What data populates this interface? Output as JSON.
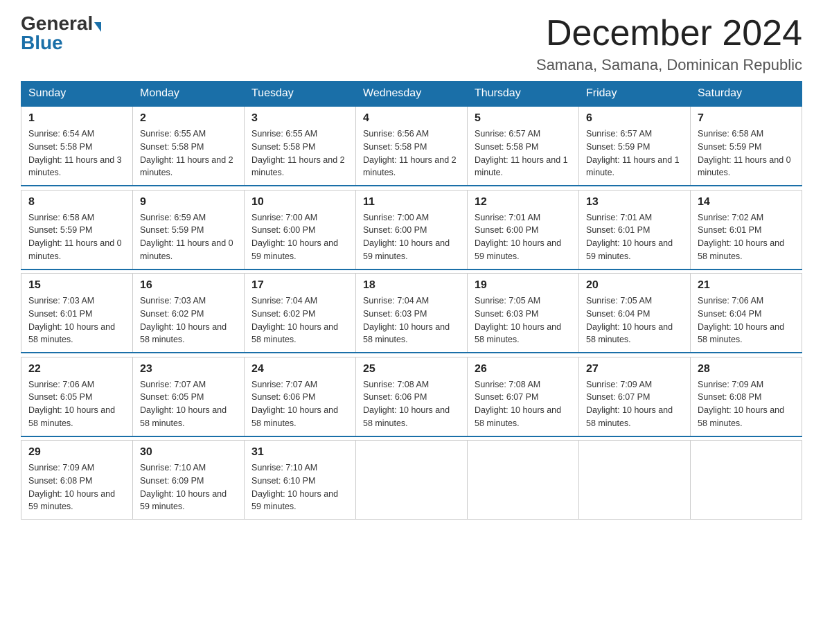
{
  "logo": {
    "general": "General",
    "blue": "Blue"
  },
  "title": "December 2024",
  "location": "Samana, Samana, Dominican Republic",
  "days_header": [
    "Sunday",
    "Monday",
    "Tuesday",
    "Wednesday",
    "Thursday",
    "Friday",
    "Saturday"
  ],
  "weeks": [
    [
      {
        "day": "1",
        "sunrise": "6:54 AM",
        "sunset": "5:58 PM",
        "daylight": "11 hours and 3 minutes."
      },
      {
        "day": "2",
        "sunrise": "6:55 AM",
        "sunset": "5:58 PM",
        "daylight": "11 hours and 2 minutes."
      },
      {
        "day": "3",
        "sunrise": "6:55 AM",
        "sunset": "5:58 PM",
        "daylight": "11 hours and 2 minutes."
      },
      {
        "day": "4",
        "sunrise": "6:56 AM",
        "sunset": "5:58 PM",
        "daylight": "11 hours and 2 minutes."
      },
      {
        "day": "5",
        "sunrise": "6:57 AM",
        "sunset": "5:58 PM",
        "daylight": "11 hours and 1 minute."
      },
      {
        "day": "6",
        "sunrise": "6:57 AM",
        "sunset": "5:59 PM",
        "daylight": "11 hours and 1 minute."
      },
      {
        "day": "7",
        "sunrise": "6:58 AM",
        "sunset": "5:59 PM",
        "daylight": "11 hours and 0 minutes."
      }
    ],
    [
      {
        "day": "8",
        "sunrise": "6:58 AM",
        "sunset": "5:59 PM",
        "daylight": "11 hours and 0 minutes."
      },
      {
        "day": "9",
        "sunrise": "6:59 AM",
        "sunset": "5:59 PM",
        "daylight": "11 hours and 0 minutes."
      },
      {
        "day": "10",
        "sunrise": "7:00 AM",
        "sunset": "6:00 PM",
        "daylight": "10 hours and 59 minutes."
      },
      {
        "day": "11",
        "sunrise": "7:00 AM",
        "sunset": "6:00 PM",
        "daylight": "10 hours and 59 minutes."
      },
      {
        "day": "12",
        "sunrise": "7:01 AM",
        "sunset": "6:00 PM",
        "daylight": "10 hours and 59 minutes."
      },
      {
        "day": "13",
        "sunrise": "7:01 AM",
        "sunset": "6:01 PM",
        "daylight": "10 hours and 59 minutes."
      },
      {
        "day": "14",
        "sunrise": "7:02 AM",
        "sunset": "6:01 PM",
        "daylight": "10 hours and 58 minutes."
      }
    ],
    [
      {
        "day": "15",
        "sunrise": "7:03 AM",
        "sunset": "6:01 PM",
        "daylight": "10 hours and 58 minutes."
      },
      {
        "day": "16",
        "sunrise": "7:03 AM",
        "sunset": "6:02 PM",
        "daylight": "10 hours and 58 minutes."
      },
      {
        "day": "17",
        "sunrise": "7:04 AM",
        "sunset": "6:02 PM",
        "daylight": "10 hours and 58 minutes."
      },
      {
        "day": "18",
        "sunrise": "7:04 AM",
        "sunset": "6:03 PM",
        "daylight": "10 hours and 58 minutes."
      },
      {
        "day": "19",
        "sunrise": "7:05 AM",
        "sunset": "6:03 PM",
        "daylight": "10 hours and 58 minutes."
      },
      {
        "day": "20",
        "sunrise": "7:05 AM",
        "sunset": "6:04 PM",
        "daylight": "10 hours and 58 minutes."
      },
      {
        "day": "21",
        "sunrise": "7:06 AM",
        "sunset": "6:04 PM",
        "daylight": "10 hours and 58 minutes."
      }
    ],
    [
      {
        "day": "22",
        "sunrise": "7:06 AM",
        "sunset": "6:05 PM",
        "daylight": "10 hours and 58 minutes."
      },
      {
        "day": "23",
        "sunrise": "7:07 AM",
        "sunset": "6:05 PM",
        "daylight": "10 hours and 58 minutes."
      },
      {
        "day": "24",
        "sunrise": "7:07 AM",
        "sunset": "6:06 PM",
        "daylight": "10 hours and 58 minutes."
      },
      {
        "day": "25",
        "sunrise": "7:08 AM",
        "sunset": "6:06 PM",
        "daylight": "10 hours and 58 minutes."
      },
      {
        "day": "26",
        "sunrise": "7:08 AM",
        "sunset": "6:07 PM",
        "daylight": "10 hours and 58 minutes."
      },
      {
        "day": "27",
        "sunrise": "7:09 AM",
        "sunset": "6:07 PM",
        "daylight": "10 hours and 58 minutes."
      },
      {
        "day": "28",
        "sunrise": "7:09 AM",
        "sunset": "6:08 PM",
        "daylight": "10 hours and 58 minutes."
      }
    ],
    [
      {
        "day": "29",
        "sunrise": "7:09 AM",
        "sunset": "6:08 PM",
        "daylight": "10 hours and 59 minutes."
      },
      {
        "day": "30",
        "sunrise": "7:10 AM",
        "sunset": "6:09 PM",
        "daylight": "10 hours and 59 minutes."
      },
      {
        "day": "31",
        "sunrise": "7:10 AM",
        "sunset": "6:10 PM",
        "daylight": "10 hours and 59 minutes."
      },
      null,
      null,
      null,
      null
    ]
  ]
}
